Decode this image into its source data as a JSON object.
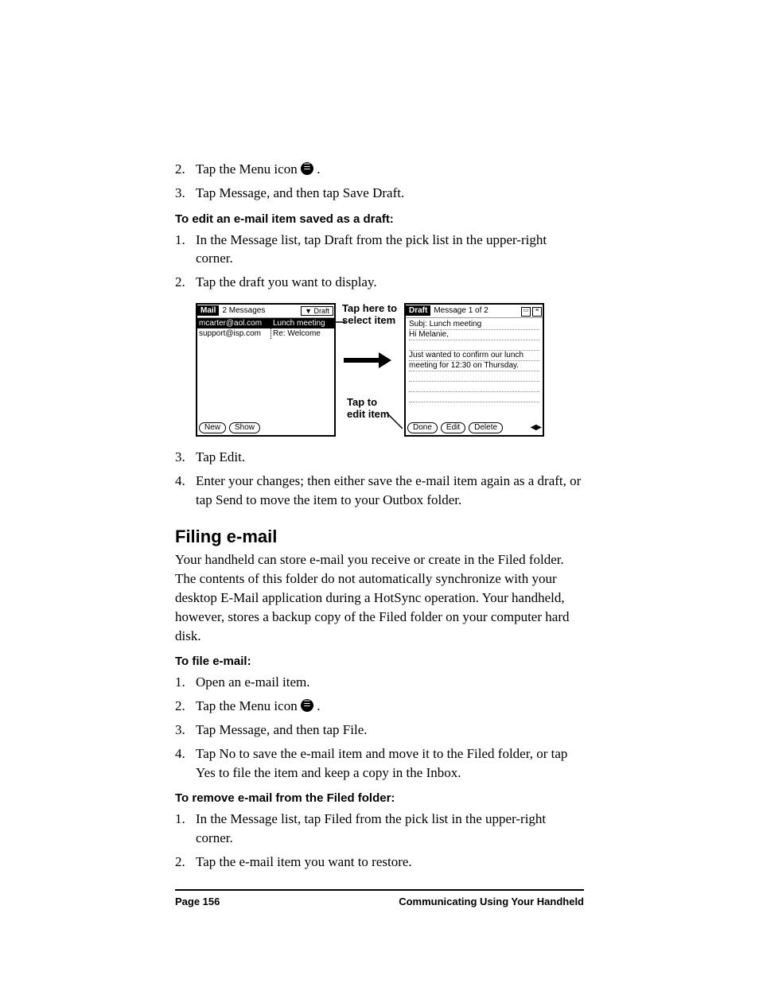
{
  "steps_a": [
    {
      "num": "2.",
      "text_before": "Tap the Menu icon ",
      "text_after": " .",
      "has_icon": true
    },
    {
      "num": "3.",
      "text": "Tap Message, and then tap Save Draft."
    }
  ],
  "subhead_edit": "To edit an e-mail item saved as a draft:",
  "steps_b": [
    {
      "num": "1.",
      "text": "In the Message list, tap Draft from the pick list in the upper-right corner."
    },
    {
      "num": "2.",
      "text": "Tap the draft you want to display."
    }
  ],
  "figure": {
    "left": {
      "title_label": "Mail",
      "title_text": "2 Messages",
      "dropdown": "▼ Draft",
      "rows": [
        {
          "c1": "mcarter@aol.com",
          "c2": "Lunch meeting",
          "sel": true
        },
        {
          "c1": "support@isp.com",
          "c2": "Re: Welcome",
          "sel": false
        }
      ],
      "buttons": [
        "New",
        "Show"
      ]
    },
    "middle": {
      "top": "Tap here to select item",
      "bottom": "Tap to edit item"
    },
    "right": {
      "title_label": "Draft",
      "title_text": "Message 1 of 2",
      "subj_label": "Subj:",
      "subj_value": "Lunch meeting",
      "body_lines": [
        "Hi Melanie,",
        "",
        "Just wanted to confirm our lunch",
        "meeting for 12:30 on Thursday."
      ],
      "buttons": [
        "Done",
        "Edit",
        "Delete"
      ]
    }
  },
  "steps_c": [
    {
      "num": "3.",
      "text": "Tap Edit."
    },
    {
      "num": "4.",
      "text": "Enter your changes; then either save the e-mail item again as a draft, or tap Send to move the item to your Outbox folder."
    }
  ],
  "section_head": "Filing e-mail",
  "section_para": "Your handheld can store e-mail you receive or create in the Filed folder. The contents of this folder do not automatically synchronize with your desktop E-Mail application during a HotSync operation. Your handheld, however, stores a backup copy of the Filed folder on your computer hard disk.",
  "subhead_file": "To file e-mail:",
  "steps_d": [
    {
      "num": "1.",
      "text": "Open an e-mail item."
    },
    {
      "num": "2.",
      "text_before": "Tap the Menu icon ",
      "text_after": " .",
      "has_icon": true
    },
    {
      "num": "3.",
      "text": "Tap Message, and then tap File."
    },
    {
      "num": "4.",
      "text": "Tap No to save the e-mail item and move it to the Filed folder, or tap Yes to file the item and keep a copy in the Inbox."
    }
  ],
  "subhead_remove": "To remove e-mail from the Filed folder:",
  "steps_e": [
    {
      "num": "1.",
      "text": "In the Message list, tap Filed from the pick list in the upper-right corner."
    },
    {
      "num": "2.",
      "text": "Tap the e-mail item you want to restore."
    }
  ],
  "footer": {
    "left": "Page 156",
    "right": "Communicating Using Your Handheld"
  },
  "menu_icon_glyph": "☰"
}
